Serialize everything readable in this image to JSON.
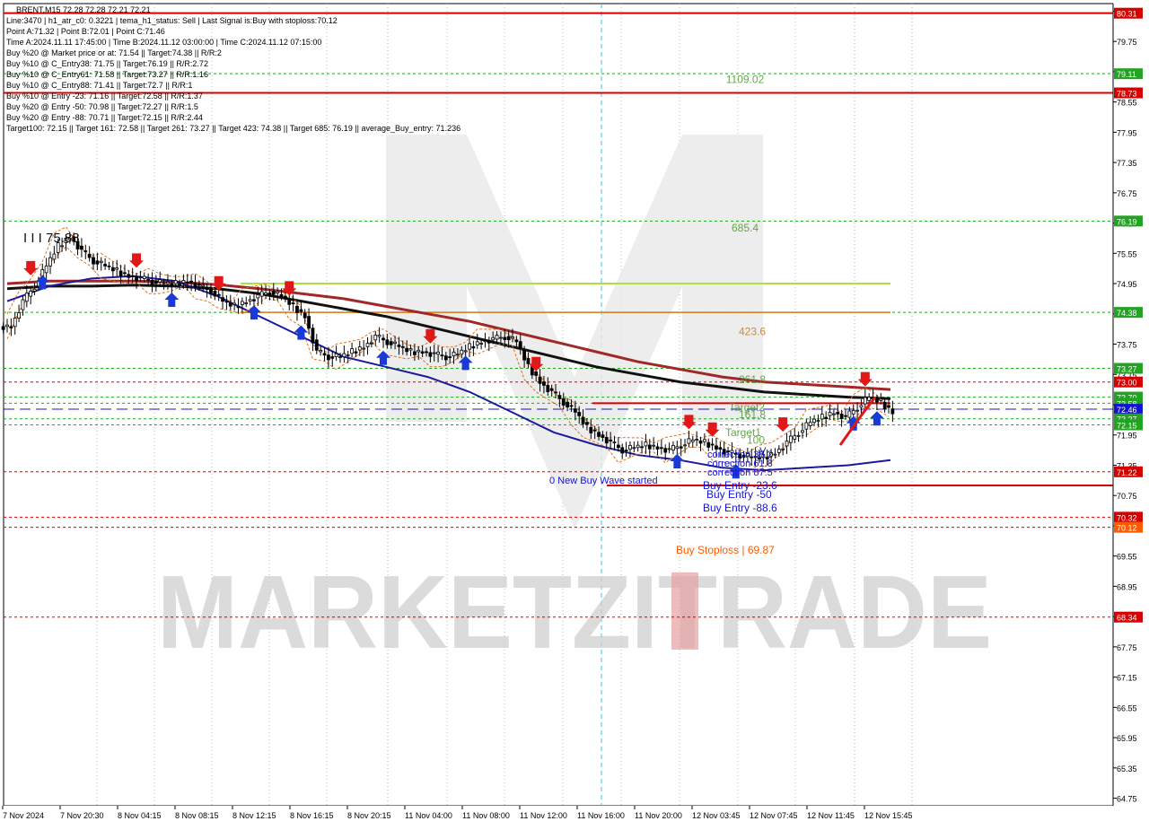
{
  "chart_data": {
    "type": "candlestick",
    "symbol_header": "BRENT,M15  72.28 72.28 72.21 72.21",
    "info_lines": [
      "Line:3470  |  h1_atr_c0: 0.3221  |  tema_h1_status: Sell  |  Last Signal is:Buy with stoploss:70.12",
      "Point A:71.32  |  Point B:72.01  |  Point C:71.46",
      "Time A:2024.11.11 17:45:00  |  Time B:2024.11.12 03:00:00  |  Time C:2024.11.12 07:15:00",
      "Buy %20 @ Market price or at: 71.54  ||  Target:74.38  ||  R/R:2",
      "Buy %10 @ C_Entry38: 71.75  ||  Target:76.19  ||  R/R:2.72",
      "Buy %10 @ C_Entry61: 71.58  ||  Target:73.27  ||  R/R:1.16",
      "Buy %10 @ C_Entry88: 71.41  ||  Target:72.7  ||  R/R:1",
      "Buy %10 @ Entry -23: 71.16  ||  Target:72.58  ||  R/R:1.37",
      "Buy %20 @ Entry -50: 70.98  ||  Target:72.27  ||  R/R:1.5",
      "Buy %20 @ Entry -88: 70.71  ||  Target:72.15  ||  R/R:2.44",
      "Target100: 72.15  ||  Target 161: 72.58  ||  Target 261: 73.27  ||  Target 423: 74.38  ||  Target 685: 76.19  ||  average_Buy_entry: 71.236"
    ],
    "y_axis_ticks": [
      "80.35",
      "79.75",
      "79.15",
      "78.55",
      "77.95",
      "77.35",
      "76.75",
      "76.15",
      "75.55",
      "74.95",
      "74.35",
      "73.75",
      "73.15",
      "72.55",
      "71.95",
      "71.35",
      "70.75",
      "70.15",
      "69.55",
      "68.95",
      "68.35",
      "67.75",
      "67.15",
      "66.55",
      "65.95",
      "65.35",
      "64.75"
    ],
    "ylim": [
      64.6,
      80.5
    ],
    "x_axis_ticks": [
      "7 Nov 2024",
      "7 Nov 20:30",
      "8 Nov 04:15",
      "8 Nov 08:15",
      "8 Nov 12:15",
      "8 Nov 16:15",
      "8 Nov 20:15",
      "11 Nov 04:00",
      "11 Nov 08:00",
      "11 Nov 12:00",
      "11 Nov 16:00",
      "11 Nov 20:00",
      "12 Nov 03:45",
      "12 Nov 07:45",
      "12 Nov 11:45",
      "12 Nov 15:45"
    ],
    "price_tags": [
      {
        "label": "80.31",
        "value": 80.31,
        "color": "#d40000"
      },
      {
        "label": "79.11",
        "value": 79.11,
        "color": "#22a322"
      },
      {
        "label": "78.73",
        "value": 78.73,
        "color": "#d40000"
      },
      {
        "label": "76.19",
        "value": 76.19,
        "color": "#22a322"
      },
      {
        "label": "74.38",
        "value": 74.38,
        "color": "#22a322"
      },
      {
        "label": "73.27",
        "value": 73.27,
        "color": "#22a322"
      },
      {
        "label": "73.00",
        "value": 73.0,
        "color": "#d40000"
      },
      {
        "label": "72.70",
        "value": 72.7,
        "color": "#22a322"
      },
      {
        "label": "72.58",
        "value": 72.58,
        "color": "#22a322"
      },
      {
        "label": "72.46",
        "value": 72.46,
        "color": "#1414d0"
      },
      {
        "label": "72.27",
        "value": 72.27,
        "color": "#22a322"
      },
      {
        "label": "72.15",
        "value": 72.15,
        "color": "#22a322"
      },
      {
        "label": "71.22",
        "value": 71.22,
        "color": "#d40000"
      },
      {
        "label": "70.32",
        "value": 70.32,
        "color": "#d40000"
      },
      {
        "label": "70.12",
        "value": 70.12,
        "color": "#ff5a00"
      },
      {
        "label": "68.34",
        "value": 68.34,
        "color": "#d40000"
      }
    ],
    "levels": [
      {
        "value": 80.31,
        "color": "#d40000",
        "style": "solid"
      },
      {
        "value": 79.11,
        "color": "#22a322",
        "style": "dotted"
      },
      {
        "value": 78.73,
        "color": "#d40000",
        "style": "solid"
      },
      {
        "value": 76.19,
        "color": "#22a322",
        "style": "dotted"
      },
      {
        "value": 74.38,
        "color": "#22a322",
        "style": "dotted"
      },
      {
        "value": 73.27,
        "color": "#22a322",
        "style": "dotted"
      },
      {
        "value": 73.0,
        "color": "#d40000",
        "style": "dotted"
      },
      {
        "value": 72.7,
        "color": "#22a322",
        "style": "dotted"
      },
      {
        "value": 72.58,
        "color": "#22a322",
        "style": "dotted"
      },
      {
        "value": 72.46,
        "color": "#1414d0",
        "style": "dashed"
      },
      {
        "value": 72.27,
        "color": "#22a322",
        "style": "dotted"
      },
      {
        "value": 72.15,
        "color": "#22a322",
        "style": "dotted"
      },
      {
        "value": 71.22,
        "color": "#d40000",
        "style": "dotted"
      },
      {
        "value": 70.32,
        "color": "#d40000",
        "style": "dotted"
      },
      {
        "value": 70.12,
        "color": "#d40000",
        "style": "dotted"
      },
      {
        "value": 68.34,
        "color": "#d40000",
        "style": "dotted"
      }
    ],
    "target_labels": [
      {
        "text": "1109.02",
        "value": 79.0,
        "color": "#4a9a2a"
      },
      {
        "text": "685.4",
        "value": 76.05,
        "color": "#4a9a2a"
      },
      {
        "text": "423.6",
        "value": 74.0,
        "color": "#c87a10"
      },
      {
        "text": "261.8",
        "value": 73.05,
        "color": "#4a9a2a"
      },
      {
        "text": "Target2",
        "value": 72.5,
        "color": "#4a9a2a"
      },
      {
        "text": "161.8",
        "value": 72.35,
        "color": "#4a9a2a"
      },
      {
        "text": "Target1",
        "value": 72.0,
        "color": "#4a9a2a"
      },
      {
        "text": "100",
        "value": 71.85,
        "color": "#4a9a2a"
      }
    ],
    "annotations": [
      {
        "text": "I I I 75.88",
        "color": "#111111"
      },
      {
        "text": "0 New Buy Wave started",
        "color": "#1414d0"
      },
      {
        "text": "correction 38.2",
        "color": "#1414d0"
      },
      {
        "text": "correction 61.8",
        "color": "#1414d0"
      },
      {
        "text": "correction 87.5",
        "color": "#1414d0"
      },
      {
        "text": "I V",
        "color": "#1414d0"
      },
      {
        "text": "Buy Entry -23.6",
        "color": "#1414d0"
      },
      {
        "text": "Buy Entry -50",
        "color": "#1414d0"
      },
      {
        "text": "Buy Entry -88.6",
        "color": "#1414d0"
      },
      {
        "text": "Buy Stoploss | 69.87",
        "color": "#ff5a00"
      }
    ],
    "watermark": "MARKETZITRADE",
    "series_close": [
      74.1,
      74.6,
      74.9,
      75.3,
      75.7,
      75.88,
      75.6,
      75.4,
      75.3,
      75.2,
      75.1,
      75.05,
      75.0,
      74.95,
      74.95,
      75.0,
      74.9,
      74.8,
      74.6,
      74.5,
      74.6,
      74.7,
      74.8,
      74.7,
      74.5,
      74.3,
      73.6,
      73.5,
      73.5,
      73.6,
      73.7,
      73.9,
      73.8,
      73.7,
      73.6,
      73.6,
      73.55,
      73.5,
      73.55,
      73.7,
      73.8,
      73.85,
      73.9,
      73.8,
      73.3,
      73.0,
      72.8,
      72.6,
      72.4,
      72.1,
      71.95,
      71.8,
      71.65,
      71.7,
      71.75,
      71.7,
      71.65,
      71.75,
      71.85,
      71.8,
      71.7,
      71.6,
      71.55,
      71.5,
      71.5,
      71.6,
      71.8,
      72.0,
      72.2,
      72.3,
      72.4,
      72.3,
      72.5,
      72.7,
      72.6,
      72.4
    ],
    "ma_black": [
      74.85,
      74.9,
      74.9,
      74.92,
      74.9,
      74.85,
      74.75,
      74.6,
      74.45,
      74.3,
      74.1,
      73.9,
      73.7,
      73.5,
      73.3,
      73.15,
      73.0,
      72.9,
      72.8,
      72.75,
      72.7,
      72.67
    ],
    "ma_brown": [
      74.95,
      75.0,
      75.0,
      75.0,
      74.98,
      74.93,
      74.85,
      74.75,
      74.65,
      74.5,
      74.35,
      74.2,
      74.0,
      73.8,
      73.6,
      73.4,
      73.25,
      73.1,
      73.0,
      72.95,
      72.9,
      72.85
    ],
    "ma_blue": [
      74.6,
      74.9,
      75.05,
      75.1,
      75.0,
      74.7,
      74.3,
      73.9,
      73.5,
      73.3,
      73.1,
      72.8,
      72.4,
      72.0,
      71.75,
      71.55,
      71.45,
      71.3,
      71.25,
      71.3,
      71.35,
      71.45
    ]
  }
}
